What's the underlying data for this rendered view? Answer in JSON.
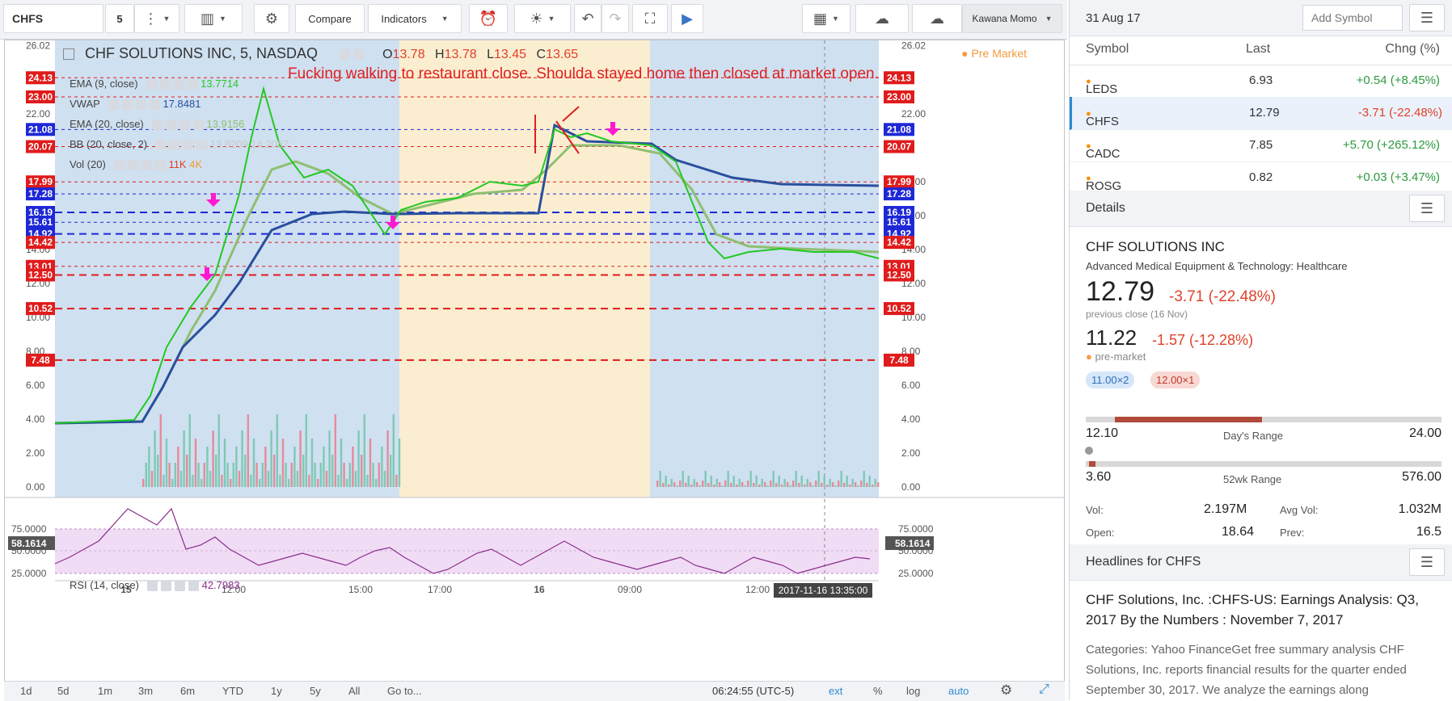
{
  "toolbar": {
    "symbol": "CHFS",
    "interval": "5",
    "compare_label": "Compare",
    "indicators_label": "Indicators",
    "layout_name": "Kawana Momo"
  },
  "chart": {
    "title": "CHF SOLUTIONS INC, 5, NASDAQ",
    "ohlc": {
      "o_label": "O",
      "o": "13.78",
      "h_label": "H",
      "h": "13.78",
      "l_label": "L",
      "l": "13.45",
      "c_label": "C",
      "c": "13.65"
    },
    "premarket_label": "Pre Market",
    "annotation": "Fucking walking to restaurant close.  Shoulda stayed home then closed at market open.",
    "indicators": [
      {
        "name": "EMA (9, close)",
        "value": "13.7714",
        "color": "#22c922"
      },
      {
        "name": "VWAP",
        "value": "17.8481",
        "color": "#2a4f9e"
      },
      {
        "name": "EMA (20, close)",
        "value": "13.9156",
        "color": "#8fbf70"
      },
      {
        "name": "BB (20, close, 2)",
        "value": "13.8209   14.2087",
        "color": "#c7c9cc"
      },
      {
        "name": "Vol (20)",
        "value": "11K",
        "value2": "4K",
        "color": "#e0412a",
        "color2": "#f39a3c"
      }
    ],
    "rsi": {
      "name": "RSI (14, close)",
      "value": "42.7983",
      "current": "58.1614"
    },
    "y_axis": [
      "26.02",
      "22.00",
      "18.00",
      "16.00",
      "14.00",
      "12.00",
      "10.00",
      "8.00",
      "6.00",
      "4.00",
      "2.00",
      "0.00"
    ],
    "rsi_axis": [
      "75.0000",
      "50.0000",
      "25.0000"
    ],
    "x_axis": [
      "15",
      "12:00",
      "15:00",
      "17:00",
      "16",
      "09:00",
      "12:00"
    ],
    "crosshair_time": "2017-11-16 13:35:00",
    "levels": [
      {
        "price": "24.13",
        "color": "red"
      },
      {
        "price": "23.00",
        "color": "red"
      },
      {
        "price": "21.08",
        "color": "blue"
      },
      {
        "price": "20.07",
        "color": "red"
      },
      {
        "price": "17.99",
        "color": "red"
      },
      {
        "price": "17.28",
        "color": "blue"
      },
      {
        "price": "16.19",
        "color": "blue"
      },
      {
        "price": "15.61",
        "color": "blue"
      },
      {
        "price": "14.92",
        "color": "blue"
      },
      {
        "price": "14.42",
        "color": "red"
      },
      {
        "price": "13.01",
        "color": "red"
      },
      {
        "price": "12.50",
        "color": "red"
      },
      {
        "price": "10.52",
        "color": "red"
      },
      {
        "price": "7.48",
        "color": "red"
      }
    ]
  },
  "bottombar": {
    "ranges": [
      "1d",
      "5d",
      "1m",
      "3m",
      "6m",
      "YTD",
      "1y",
      "5y",
      "All"
    ],
    "goto": "Go to...",
    "clock": "06:24:55 (UTC-5)",
    "ext": "ext",
    "pct": "%",
    "log": "log",
    "auto": "auto"
  },
  "watchlist": {
    "date": "31 Aug 17",
    "add_placeholder": "Add Symbol",
    "columns": [
      "Symbol",
      "Last",
      "Chng (%)"
    ],
    "rows": [
      {
        "symbol": "LEDS",
        "last": "6.93",
        "chng": "+0.54 (+8.45%)",
        "dir": "pos"
      },
      {
        "symbol": "CHFS",
        "last": "12.79",
        "chng": "-3.71 (-22.48%)",
        "dir": "neg"
      },
      {
        "symbol": "CADC",
        "last": "7.85",
        "chng": "+5.70 (+265.12%)",
        "dir": "pos"
      },
      {
        "symbol": "ROSG",
        "last": "0.82",
        "chng": "+0.03 (+3.47%)",
        "dir": "pos"
      }
    ]
  },
  "details": {
    "header": "Details",
    "company": "CHF SOLUTIONS INC",
    "sector": "Advanced Medical Equipment & Technology: Healthcare",
    "price": "12.79",
    "change": "-3.71 (-22.48%)",
    "prev_close_note": "previous close (16 Nov)",
    "pre_price": "11.22",
    "pre_change": "-1.57 (-12.28%)",
    "pre_label": "pre-market",
    "bid": "11.00×2",
    "ask": "12.00×1",
    "days_low": "12.10",
    "days_label": "Day's Range",
    "days_high": "24.00",
    "wk_low": "3.60",
    "wk_label": "52wk Range",
    "wk_high": "576.00",
    "vol_label": "Vol:",
    "vol": "2.197M",
    "avgvol_label": "Avg Vol:",
    "avgvol": "1.032M",
    "open_label": "Open:",
    "open": "18.64",
    "prev_label": "Prev:",
    "prev": "16.5"
  },
  "headlines": {
    "header": "Headlines for CHFS",
    "title": "CHF Solutions, Inc. :CHFS-US: Earnings Analysis: Q3, 2017 By the Numbers : November 7, 2017",
    "body": "Categories: Yahoo FinanceGet free summary analysis CHF Solutions, Inc. reports financial results for the quarter ended September 30, 2017. We analyze the earnings along"
  }
}
